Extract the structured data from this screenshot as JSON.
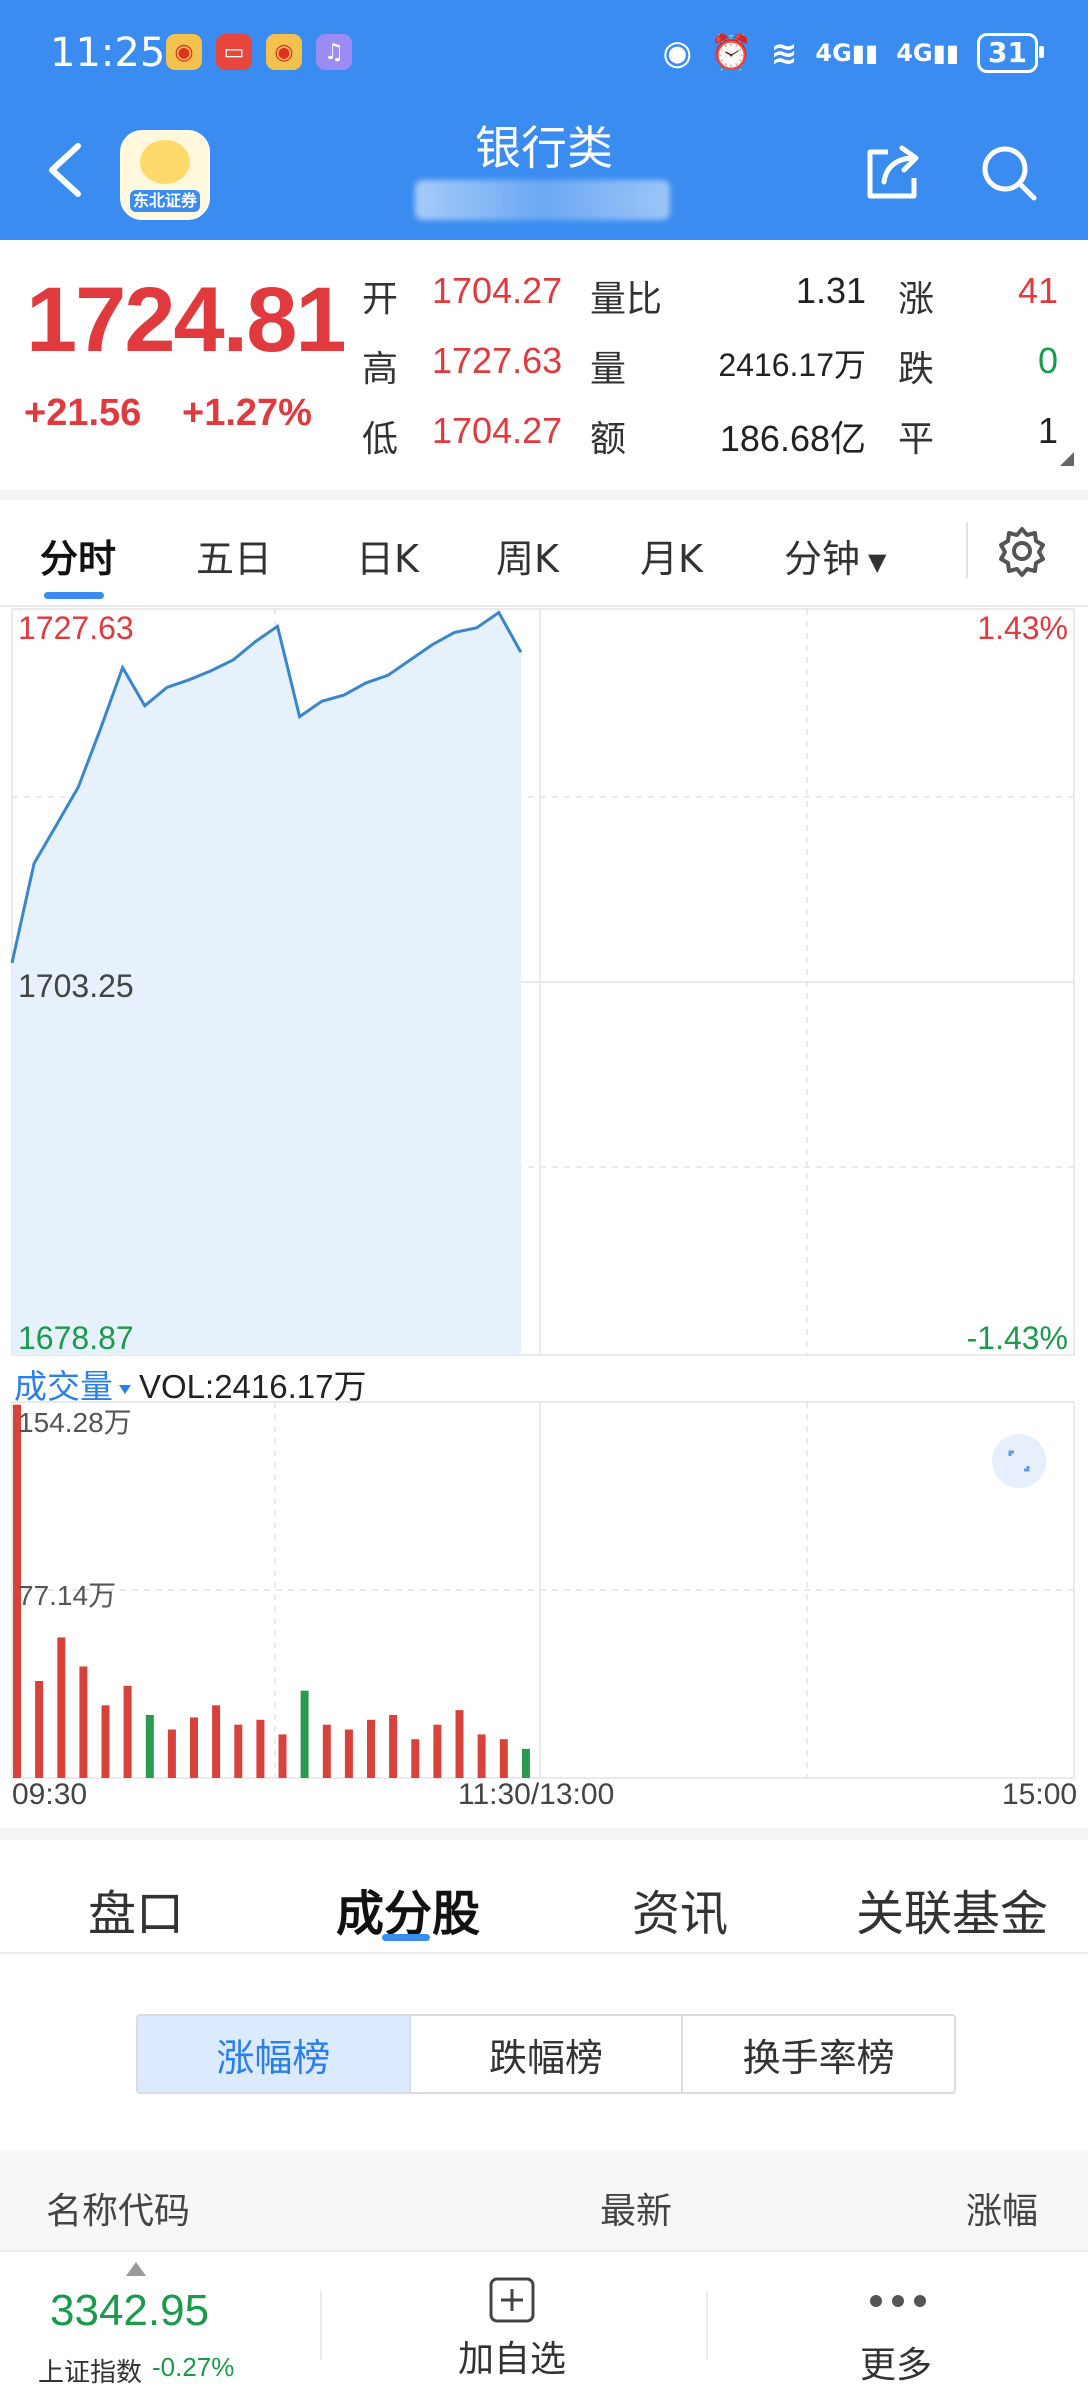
{
  "status_bar": {
    "time": "11:25",
    "battery": "31",
    "network_1": "4G",
    "network_2": "4G"
  },
  "header": {
    "title": "银行类",
    "logo_text": "东北证券"
  },
  "quote": {
    "price": "1724.81",
    "change": "+21.56",
    "change_pct": "+1.27%",
    "rows": [
      {
        "l1": "开",
        "v1": "1704.27",
        "l2": "量比",
        "v2": "1.31",
        "l3": "涨",
        "v3": "41"
      },
      {
        "l1": "高",
        "v1": "1727.63",
        "l2": "量",
        "v2": "2416.17万",
        "l3": "跌",
        "v3": "0"
      },
      {
        "l1": "低",
        "v1": "1704.27",
        "l2": "额",
        "v2": "186.68亿",
        "l3": "平",
        "v3": "1"
      }
    ]
  },
  "period_tabs": [
    "分时",
    "五日",
    "日K",
    "周K",
    "月K",
    "分钟"
  ],
  "price_chart": {
    "y_high": "1727.63",
    "y_mid": "1703.25",
    "y_low": "1678.87",
    "pct_high": "1.43%",
    "pct_low": "-1.43%"
  },
  "volume": {
    "label": "成交量",
    "value": "VOL:2416.17万",
    "y_high": "154.28万",
    "y_mid": "77.14万"
  },
  "time_axis": {
    "start": "09:30",
    "mid": "11:30/13:00",
    "end": "15:00"
  },
  "section_tabs": [
    "盘口",
    "成分股",
    "资讯",
    "关联基金"
  ],
  "rank_tabs": [
    "涨幅榜",
    "跌幅榜",
    "换手率榜"
  ],
  "list_header": {
    "name": "名称代码",
    "latest": "最新",
    "change": "涨幅"
  },
  "bottom_bar": {
    "index_value": "3342.95",
    "index_name": "上证指数",
    "index_pct": "-0.27%",
    "add_label": "加自选",
    "more_label": "更多"
  },
  "chart_data": {
    "type": "line",
    "x": [
      "09:30",
      "09:35",
      "09:40",
      "09:45",
      "09:50",
      "09:55",
      "10:00",
      "10:05",
      "10:10",
      "10:15",
      "10:20",
      "10:25",
      "10:30",
      "10:35",
      "10:40",
      "10:45",
      "10:50",
      "10:55",
      "11:00",
      "11:05",
      "11:10",
      "11:15",
      "11:20",
      "11:25"
    ],
    "values": [
      1704.5,
      1711.0,
      1713.5,
      1716.0,
      1719.8,
      1723.8,
      1721.3,
      1722.5,
      1723.0,
      1723.6,
      1724.3,
      1725.5,
      1726.5,
      1720.6,
      1721.6,
      1722.0,
      1722.8,
      1723.3,
      1724.3,
      1725.3,
      1726.1,
      1726.4,
      1727.4,
      1724.8
    ],
    "ylim": [
      1678.87,
      1727.63
    ],
    "volume_values": [
      154,
      40,
      58,
      46,
      30,
      38,
      26,
      20,
      25,
      30,
      22,
      24,
      18,
      36,
      22,
      20,
      24,
      26,
      16,
      22,
      28,
      18,
      16,
      12
    ],
    "volume_ylim": [
      0,
      154.28
    ],
    "series": [
      {
        "name": "成交量",
        "values": [
          154,
          40,
          58,
          46,
          30,
          38,
          26,
          20,
          25,
          30,
          22,
          24,
          18,
          36,
          22,
          20,
          24,
          26,
          16,
          22,
          28,
          18,
          16,
          12
        ]
      }
    ],
    "grid": true,
    "colors": {
      "line": "#3a85cc",
      "fill": "#e6f1fc",
      "up": "#d8423a",
      "down": "#2a9a4e"
    }
  }
}
